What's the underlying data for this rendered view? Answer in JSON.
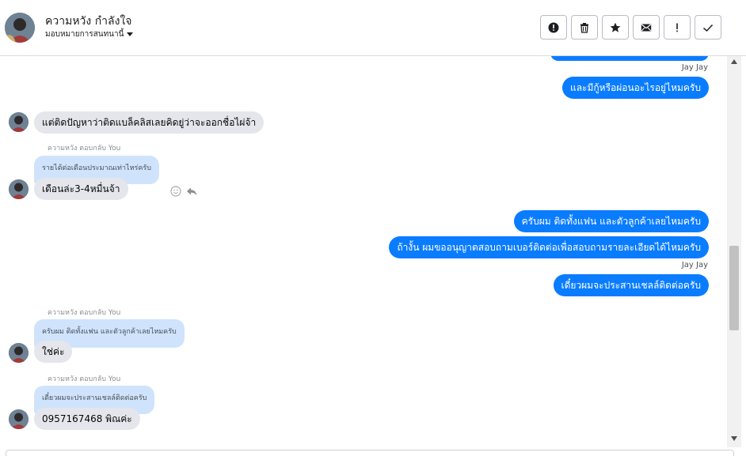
{
  "header": {
    "contact_name": "ความหวัง กำลังใจ",
    "assign_label": "มอบหมายการสนทนานี้",
    "actions": [
      {
        "icon": "alert-circle-icon",
        "label": "!"
      },
      {
        "icon": "trash-icon"
      },
      {
        "icon": "star-icon"
      },
      {
        "icon": "envelope-icon"
      },
      {
        "icon": "exclamation-icon",
        "label": "!"
      },
      {
        "icon": "check-icon"
      }
    ]
  },
  "messages": {
    "sender_label_1": "Jay Jay",
    "out_1": "และมีกู้หรือผ่อนอะไรอยู่ไหมครับ",
    "in_1": "แต่ติดปัญหาว่าติดแบล็คลิสเลยคิดยู่ว่าจะออกชื่อไผ่จ้า",
    "reply_label_1": "ความหวัง ตอบกลับ You",
    "quote_1": "รายได้ต่อเดือนประมาณเท่าไหร่ครับ",
    "in_2": "เดือนล่ะ3-4หมื่นจ้า",
    "out_2": "ครับผม ติดทั้งแฟน และตัวลูกค้าเลยไหมครับ",
    "out_3": "ถ้างั้น ผมขออนุญาตสอบถามเบอร์ติดต่อเพื่อสอบถามรายละเอียดได้ไหมครับ",
    "sender_label_2": "Jay Jay",
    "out_4": "เดี๋ยวผมจะประสานเชลล์ติดต่อครับ",
    "reply_label_2": "ความหวัง ตอบกลับ You",
    "quote_2": "ครับผม ติดทั้งแฟน และตัวลูกค้าเลยไหมครับ",
    "in_3": "ใช่ค่ะ",
    "reply_label_3": "ความหวัง ตอบกลับ You",
    "quote_3": "เดี๋ยวผมจะประสานเชลล์ติดต่อครับ",
    "in_4": "0957167468  พิณค่ะ"
  },
  "colors": {
    "outgoing": "#0a7cff",
    "incoming": "#e4e6eb",
    "quote": "#cfe3fd"
  }
}
